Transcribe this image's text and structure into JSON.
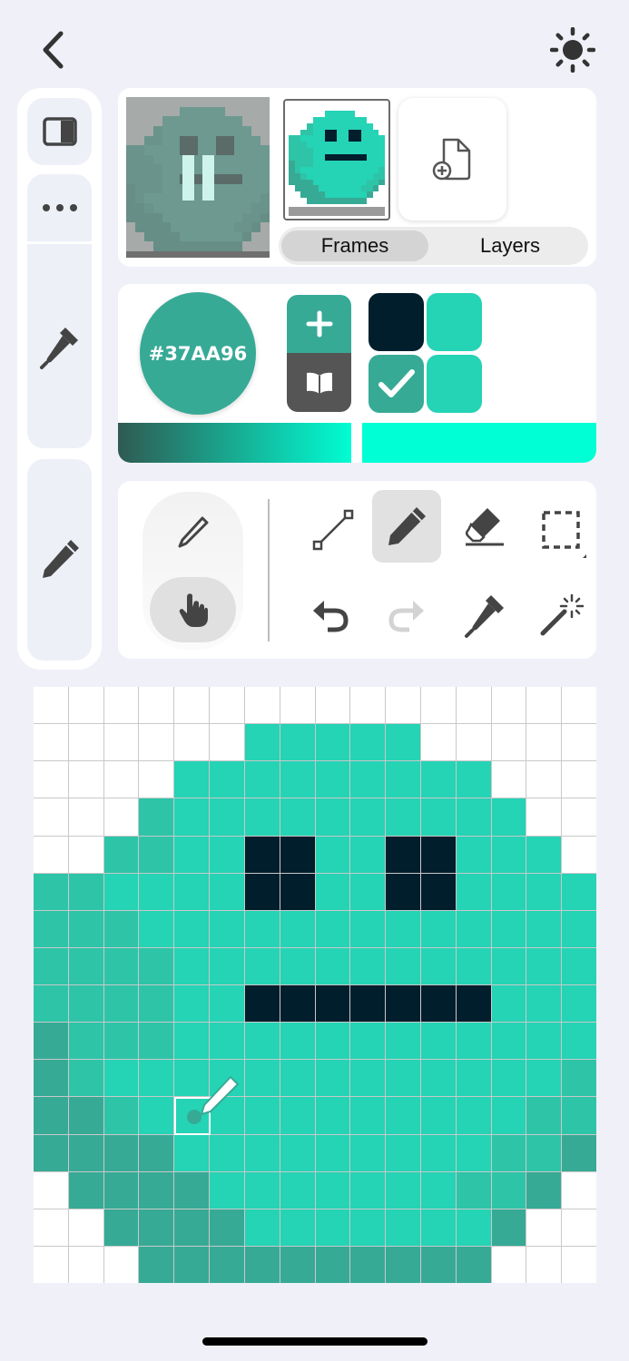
{
  "header": {
    "back_icon": "chevron-left-icon",
    "theme_icon": "sun-icon"
  },
  "sidebar": {
    "items": [
      {
        "icon": "panel-toggle-icon"
      },
      {
        "icon": "more-dots-icon"
      },
      {
        "icon": "eyedropper-icon"
      },
      {
        "icon": "pencil-icon"
      }
    ]
  },
  "frames_panel": {
    "play_state": "paused",
    "add_frame_icon": "add-file-icon",
    "tabs": [
      "Frames",
      "Layers"
    ],
    "active_tab": "Frames"
  },
  "color_panel": {
    "current_hex": "#37AA96",
    "current_color": "#37aa96",
    "palette": [
      "#001e2c",
      "#25d3b5",
      "#37aa96",
      "#25d3b5"
    ],
    "selected_swatch_index": 2,
    "add_icon": "plus-icon",
    "library_icon": "book-icon",
    "gradient": {
      "from": "#2f5a52",
      "to": "#00ffd5",
      "marker_position": 0.51
    }
  },
  "tools": {
    "mode": [
      "pencil-mode",
      "hand-mode"
    ],
    "active_mode": "hand-mode",
    "items": [
      "line-tool",
      "pencil-tool",
      "eraser-tool",
      "select-tool",
      "undo",
      "redo",
      "eyedropper-tool",
      "magic-wand-tool"
    ],
    "active_tool": "pencil-tool"
  },
  "canvas": {
    "cols": 16,
    "rows": 16,
    "palette": {
      "0": "#ffffff",
      "1": "#25d3b5",
      "2": "#2ec4a8",
      "3": "#37aa96",
      "4": "#001e2c"
    },
    "pixels": [
      "0000000000000000",
      "0000001111100000",
      "0000111111111000",
      "0002111111111100",
      "0022114411441110",
      "2211114411441111",
      "2221111111111111",
      "2222111111111111",
      "2222114444444111",
      "3222111111111111",
      "3211111111111112",
      "3321111111111122",
      "3333111111111223",
      "0333311111112230",
      "0033331111111300",
      "0003333333333000"
    ],
    "cursor": {
      "col": 4,
      "row": 11
    }
  }
}
